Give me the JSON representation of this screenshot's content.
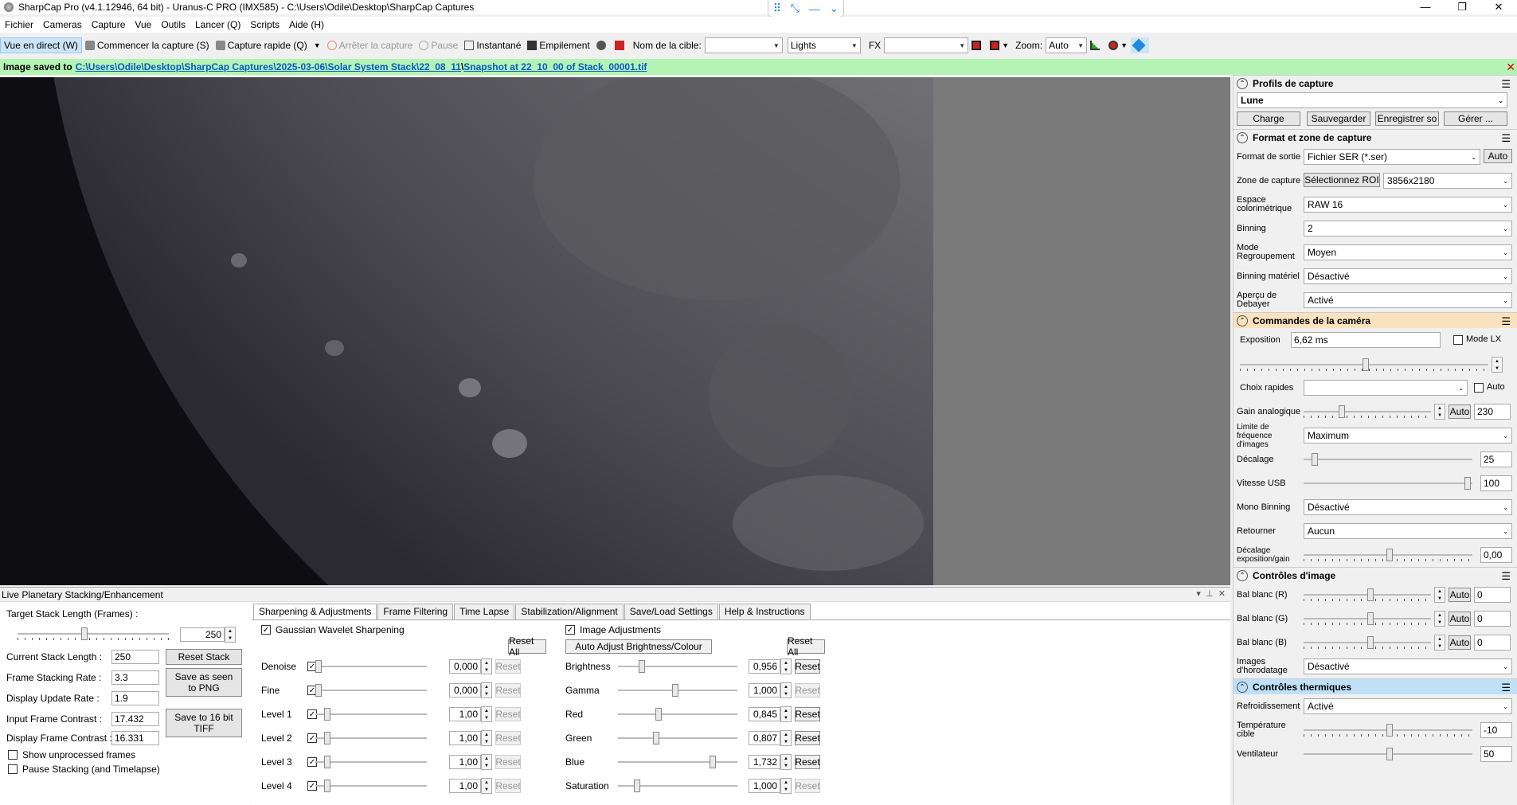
{
  "window": {
    "title": "SharpCap Pro (v4.1.12946, 64 bit) - Uranus-C PRO (IMX585) - C:\\Users\\Odile\\Desktop\\SharpCap Captures",
    "minimize": "—",
    "maximize": "❐",
    "close": "✕"
  },
  "floatbar": {
    "grid": "⠿",
    "shrink": "⤡",
    "min": "—",
    "down": "⌄"
  },
  "menu": [
    "Fichier",
    "Cameras",
    "Capture",
    "Vue",
    "Outils",
    "Lancer (Q)",
    "Scripts",
    "Aide (H)"
  ],
  "toolbar": {
    "live_view": "Vue en direct (W)",
    "start_capture": "Commencer la capture (S)",
    "quick_capture": "Capture rapide (Q)",
    "stop_capture": "Arrêter la capture",
    "pause": "Pause",
    "snapshot": "Instantané",
    "stacking": "Empilement",
    "target_label": "Nom de la cible:",
    "target_value": "",
    "frame_type": "Lights",
    "fx_label": "FX",
    "fx_value": "",
    "zoom_label": "Zoom:",
    "zoom_value": "Auto"
  },
  "infobar": {
    "prefix": "Image saved to",
    "path1": "C:\\Users\\Odile\\Desktop\\SharpCap Captures\\2025-03-06\\Solar System Stack\\22_08_11",
    "sep": "\\",
    "path2": "Snapshot at 22_10_00 of Stack_00001.tif"
  },
  "right": {
    "profiles": {
      "title": "Profils de capture",
      "selected": "Lune",
      "btn_load": "Charge",
      "btn_save": "Sauvegarder",
      "btn_saveas": "Enregistrer so",
      "btn_manage": "Gérer ..."
    },
    "format": {
      "title": "Format et zone de capture",
      "output_label": "Format de sortie",
      "output_value": "Fichier SER (*.ser)",
      "auto_btn": "Auto",
      "zone_label": "Zone de capture",
      "roi_btn": "Sélectionnez ROI",
      "zone_value": "3856x2180",
      "colorspace_label": "Espace colorimétrique",
      "colorspace_value": "RAW 16",
      "binning_label": "Binning",
      "binning_value": "2",
      "mode_label": "Mode Regroupement",
      "mode_value": "Moyen",
      "hwbin_label": "Binning matériel",
      "hwbin_value": "Désactivé",
      "debayer_label": "Aperçu de Debayer",
      "debayer_value": "Activé"
    },
    "camera": {
      "title": "Commandes de la caméra",
      "exposure_label": "Exposition",
      "exposure_value": "6,62 ms",
      "lx_label": "Mode LX",
      "quick_label": "Choix rapides",
      "quick_value": "",
      "auto_label": "Auto",
      "gain_label": "Gain analogique",
      "gain_auto": "Auto",
      "gain_value": "230",
      "fps_label": "Limite de fréquence d'images",
      "fps_value": "Maximum",
      "offset_label": "Décalage",
      "offset_value": "25",
      "usb_label": "Vitesse USB",
      "usb_value": "100",
      "monobin_label": "Mono Binning",
      "monobin_value": "Désactivé",
      "flip_label": "Retourner",
      "flip_value": "Aucun",
      "expgain_label": "Décalage exposition/gain",
      "expgain_value": "0,00"
    },
    "image": {
      "title": "Contrôles d'image",
      "wbr_label": "Bal blanc (R)",
      "wbr_value": "0",
      "wbg_label": "Bal blanc (G)",
      "wbg_value": "0",
      "wbb_label": "Bal blanc (B)",
      "wbb_value": "0",
      "auto": "Auto",
      "timestamp_label": "Images d'horodatage",
      "timestamp_value": "Désactivé"
    },
    "thermal": {
      "title": "Contrôles thermiques",
      "cooling_label": "Refroidissement",
      "cooling_value": "Activé",
      "target_label": "Température cible",
      "target_value": "-10",
      "fan_label": "Ventilateur",
      "fan_value": "50"
    }
  },
  "stack": {
    "title": "Live Planetary Stacking/Enhancement",
    "target_len_label": "Target Stack Length (Frames) :",
    "target_len_value": "250",
    "cur_len_label": "Current Stack Length :",
    "cur_len_value": "250",
    "reset_stack": "Reset Stack",
    "rate_label": "Frame Stacking Rate :",
    "rate_value": "3.3",
    "save_png": "Save as seen to PNG",
    "update_label": "Display Update Rate :",
    "update_value": "1.9",
    "input_contrast_label": "Input Frame Contrast :",
    "input_contrast_value": "17.432",
    "save_tiff": "Save to 16 bit TIFF",
    "display_contrast_label": "Display Frame Contrast :",
    "display_contrast_value": "16.331",
    "show_unproc": "Show unprocessed frames",
    "pause_stack": "Pause Stacking (and Timelapse)"
  },
  "tabs": [
    "Sharpening & Adjustments",
    "Frame Filtering",
    "Time Lapse",
    "Stabilization/Alignment",
    "Save/Load Settings",
    "Help & Instructions"
  ],
  "sharpen": {
    "title": "Gaussian Wavelet Sharpening",
    "reset_all": "Reset All",
    "reset": "Reset",
    "rows": [
      {
        "label": "Denoise",
        "value": "0,000",
        "level": 0.0
      },
      {
        "label": "Fine",
        "value": "0,000",
        "level": 0.0
      },
      {
        "label": "Level 1",
        "value": "1,00",
        "level": 0.08
      },
      {
        "label": "Level 2",
        "value": "1,00",
        "level": 0.08
      },
      {
        "label": "Level 3",
        "value": "1,00",
        "level": 0.08
      },
      {
        "label": "Level 4",
        "value": "1,00",
        "level": 0.08
      }
    ]
  },
  "adjust": {
    "title": "Image Adjustments",
    "auto_btn": "Auto Adjust Brightness/Colour",
    "reset_all": "Reset All",
    "reset": "Reset",
    "rows": [
      {
        "label": "Brightness",
        "value": "0,956",
        "level": 0.18
      },
      {
        "label": "Gamma",
        "value": "1,000",
        "level": 0.48
      },
      {
        "label": "Red",
        "value": "0,845",
        "level": 0.33
      },
      {
        "label": "Green",
        "value": "0,807",
        "level": 0.31
      },
      {
        "label": "Blue",
        "value": "1,732",
        "level": 0.81
      },
      {
        "label": "Saturation",
        "value": "1,000",
        "level": 0.14
      }
    ]
  },
  "colors": {
    "accent": "#1e88e5",
    "infobar": "#b3f3b3",
    "orange": "#fbe2bf",
    "blue": "#bfe0f7"
  }
}
